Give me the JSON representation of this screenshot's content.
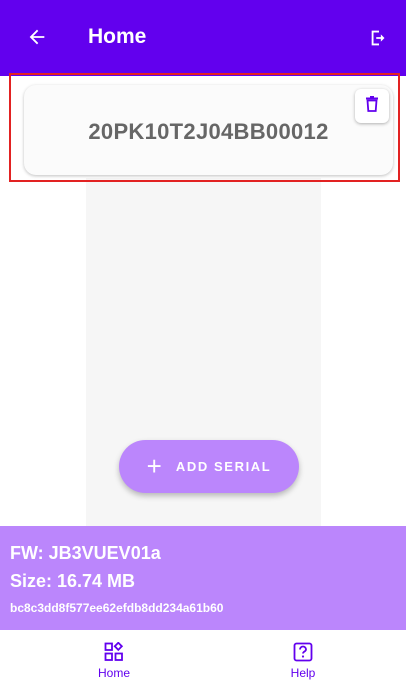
{
  "appbar": {
    "title": "Home",
    "back_icon": "arrow-left-icon",
    "logout_icon": "logout-icon",
    "color": "#6200ee"
  },
  "serial_card": {
    "serial": "20PK10T2J04BB00012",
    "delete_icon": "trash-icon",
    "highlight_color": "#e22222"
  },
  "fab": {
    "icon": "plus-icon",
    "plus_glyph": "+",
    "label": "ADD SERIAL",
    "color": "#bb86fc"
  },
  "firmware": {
    "fw_line": "FW: JB3VUEV01a",
    "size_line": "Size: 16.74 MB",
    "hash": "bc8c3dd8f577ee62efdb8dd234a61b60"
  },
  "bottom_nav": {
    "items": [
      {
        "label": "Home",
        "icon": "home-dashboard-icon"
      },
      {
        "label": "Help",
        "icon": "help-icon"
      }
    ]
  }
}
